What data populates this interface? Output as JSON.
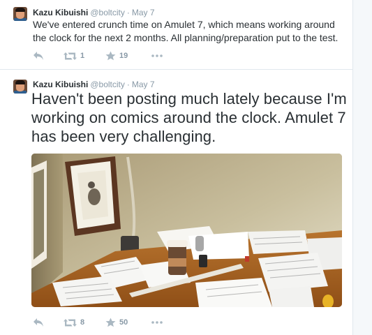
{
  "tweets": [
    {
      "author": {
        "name": "Kazu Kibuishi",
        "handle": "@boltcity"
      },
      "separator": "·",
      "time": "May 7",
      "text": "We've entered crunch time on Amulet 7, which means working around the clock for the next 2 months. All planning/preparation put to the test.",
      "stats": {
        "retweets": "1",
        "favorites": "19"
      }
    },
    {
      "author": {
        "name": "Kazu Kibuishi",
        "handle": "@boltcity"
      },
      "separator": "·",
      "time": "May 7",
      "text": "Haven't been posting much lately because I'm working on comics around the clock. Amulet 7 has been very challenging.",
      "stats": {
        "retweets": "8",
        "favorites": "50"
      }
    }
  ],
  "icons": {
    "reply": "reply-icon",
    "retweet": "retweet-icon",
    "favorite": "star-icon",
    "more": "more-dots-icon"
  },
  "colors": {
    "text": "#292f33",
    "secondary_text": "#8899a6",
    "action_icon": "#aab8c2",
    "border": "#e1e8ed",
    "background": "#f5f8fa"
  }
}
